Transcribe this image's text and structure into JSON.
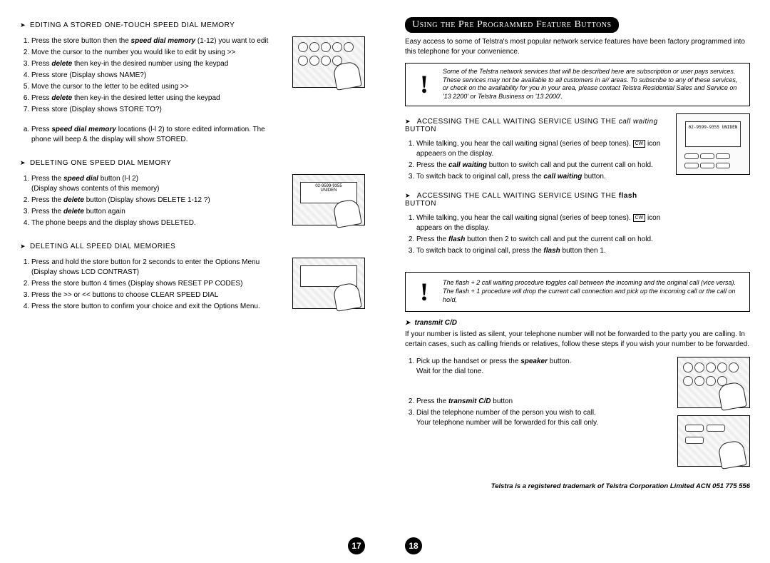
{
  "left": {
    "sec1": {
      "title": "EDITING A STORED ONE-TOUCH SPEED DIAL MEMORY",
      "steps": [
        "Press the store button then the <b class='i'>speed dial memory</b> (1-12) you want to edit",
        "Move the cursor to the number you would like to edit by using >>",
        "Press <b class='i'>delete</b> then key-in the desired number using the keypad",
        "Press store (Display shows NAME?)",
        "Move the cursor to the letter to be edited using >>",
        "Press <b class='i'>delete</b> then key-in the desired letter using the keypad",
        "Press store (Display shows STORE TO?)"
      ],
      "alpha": "Press <b class='i'>speed dial memory</b> locations (l-l 2) to store edited information. The phone will beep & the display will show STORED."
    },
    "sec2": {
      "title": "DELETING ONE SPEED DIAL MEMORY",
      "steps": [
        "Press the <b class='i'>speed dial</b> button (l-l 2)<br>(Display shows contents of this memory)",
        "Press the <b class='i'>delete</b> button (Display shows DELETE 1-12 ?)",
        "Press the <b class='i'>delete</b> button again",
        "The phone beeps and the display shows DELETED."
      ]
    },
    "sec3": {
      "title": "DELETING ALL SPEED DIAL MEMORIES",
      "steps": [
        "Press and hold the store button for 2 seconds to enter the Options Menu (Display shows LCD CONTRAST)",
        "Press the store button 4 times (Display shows RESET PP CODES)",
        "Press the >> or << buttons to choose CLEAR SPEED DIAL",
        "Press the store button to confirm your choice and exit the Options Menu."
      ]
    },
    "pagenum": "17"
  },
  "right": {
    "banner": "Using the Pre Programmed Feature Buttons",
    "intro": "Easy access to some of Telstra's most popular network service features have been factory programmed into this telephone for your convenience.",
    "note1": "Some of the Telstra network services that will be described here are subscription or user pays services. These services may not be available to all customers in a// areas. To subscribe to any of these services, or check on the availability for you in your area, please contact Telstra Residential Sales and Service on '13 2200' or Telstra Business on '13 2000'.",
    "sec1": {
      "title_pre": "ACCESSING THE CALL WAITING SERVICE USING THE ",
      "title_em": "call waiting",
      "title_post": " BUTTON",
      "steps": [
        "While talking, you hear the call waiting signal (series of beep tones). <span class='cwicon'>CW</span> icon appeaers on the display.",
        "Press the <b class='i'>call waiting</b> button to switch call and put the current call on hold.",
        "To switch back to original call, press the <b class='i'>call waiting</b> button."
      ]
    },
    "sec2": {
      "title_pre": "ACCESSING THE CALL WAITING SERVICE USING THE ",
      "title_em": "flash",
      "title_post": " BUTTON",
      "steps": [
        "While talking, you hear the call waiting signal (series of beep tones). <span class='cwicon'>CW</span> icon appears on the display.",
        "Press the <b class='i'>flash</b> button then 2 to switch call and put the current call on hold.",
        "To switch back to original call, press the <b class='i'>flash</b> button then 1."
      ]
    },
    "note2": "The flash + 2 call waiting procedure toggles call between the incoming and the original call (vice versa). The flash + 1 procedure will drop the current call connection and pick up the incoming call or the call on ho/d,",
    "sec3": {
      "title": "transmit C/D",
      "intro": "If your number is listed as silent, your telephone number will not be forwarded to the party you are calling. In certain cases, such as calling friends or relatives, follow these steps if you wish your number to be forwarded.",
      "steps": [
        "Pick up the handset or press the <b class='i'>speaker</b> button.<br>Wait for the dial tone.",
        "Press the <b class='i'>transmit C/D</b> button",
        "Dial the telephone number of the person you wish to call.<br>Your telephone number will be forwarded for this call only."
      ]
    },
    "trademark": "Telstra is a registered trademark of Telstra Corporation Limited ACN 051 775 556",
    "pagenum": "18",
    "screen_text": "02-9599-9355 UNIDEN"
  }
}
